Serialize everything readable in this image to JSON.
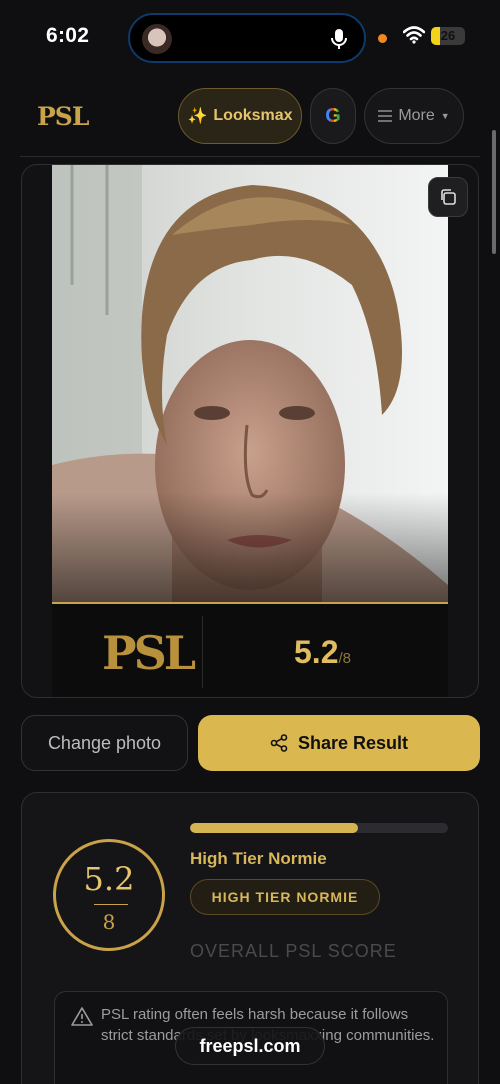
{
  "status_bar": {
    "time": "6:02",
    "battery_level": "26",
    "battery_fraction": 0.26,
    "icons": [
      "island-avatar-icon",
      "mic-icon",
      "recording-dot-icon",
      "wifi-icon",
      "battery-icon"
    ]
  },
  "nav": {
    "logo": "PSL",
    "looksmax_label": "Looksmax",
    "looksmax_icon": "sparkles-icon",
    "google_icon": "google-icon",
    "google_glyph": "G",
    "more_label": "More",
    "more_icons": [
      "menu-icon",
      "caret-down-icon"
    ]
  },
  "result_card": {
    "copy_icon": "copy-icon",
    "logo": "PSL",
    "score": "5.2",
    "denominator": "/8"
  },
  "actions": {
    "change_photo_label": "Change photo",
    "share_label": "Share Result",
    "share_icon": "share-icon"
  },
  "score_card": {
    "ring_score": "5.2",
    "ring_denominator": "8",
    "progress_fraction": 0.65,
    "tier_title": "High Tier Normie",
    "tier_badge": "HIGH TIER NORMIE",
    "overall_label": "OVERALL PSL SCORE",
    "notice_icon": "warning-icon",
    "notice_text": "PSL rating often feels harsh because it follows strict standards set by looksmaxxing communities."
  },
  "watermark": "freepsl.com",
  "colors": {
    "gold": "#c9a24a",
    "gold_button": "#dab84f",
    "background": "#0f0f11"
  }
}
